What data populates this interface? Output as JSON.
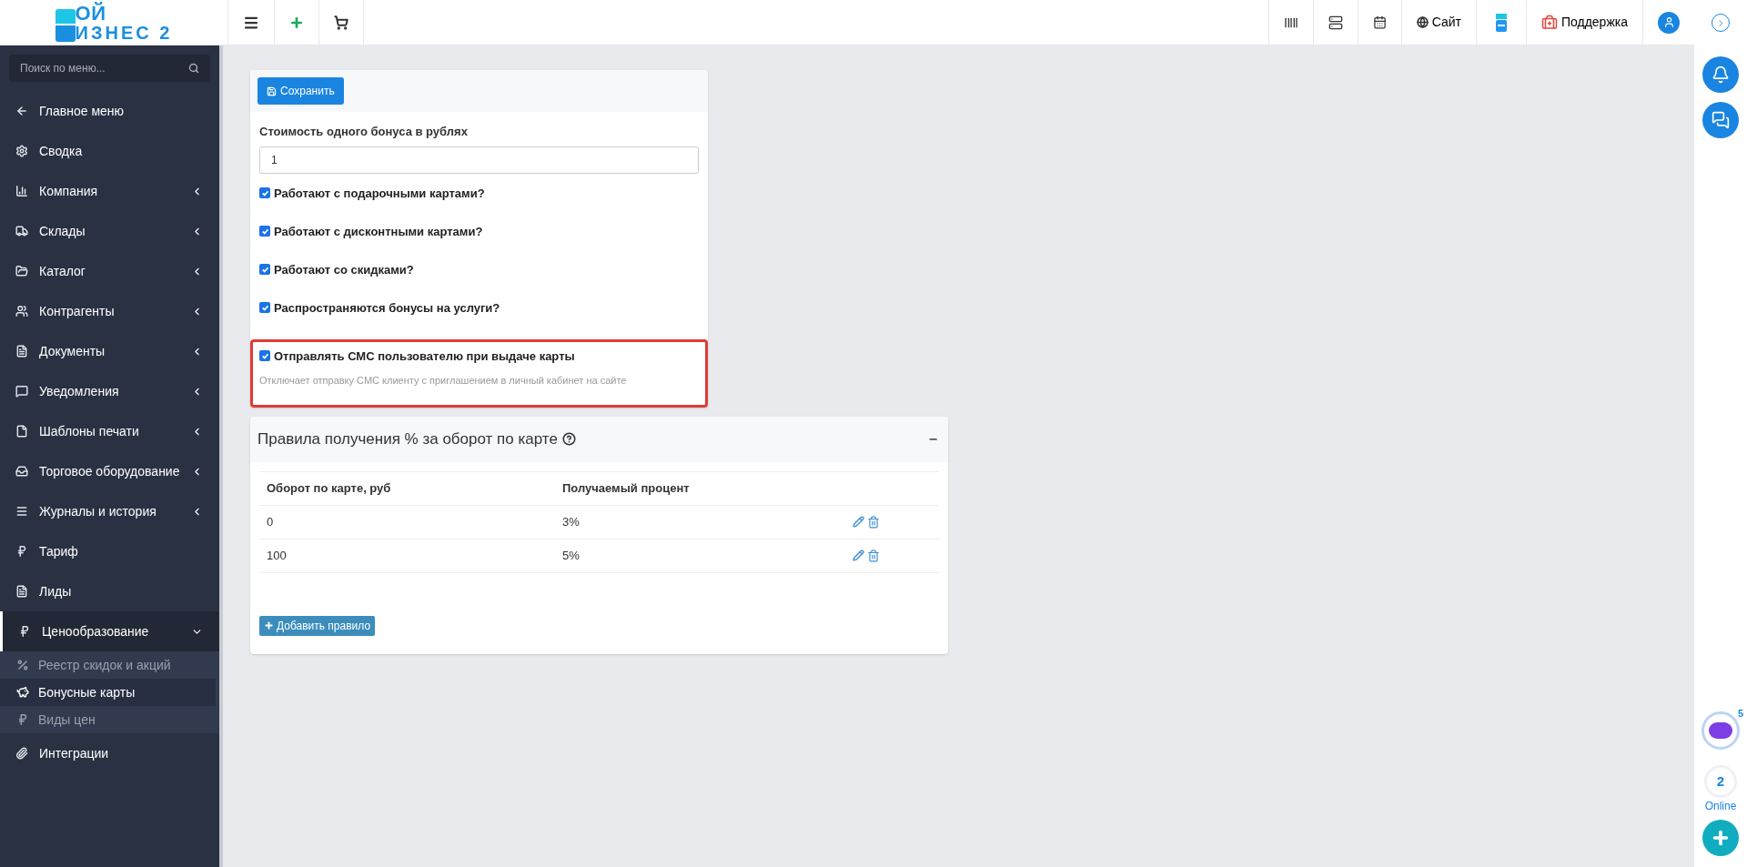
{
  "logo": {
    "line1": "ОЙ",
    "line2": "ИЗНЕС 2"
  },
  "topbar": {
    "site_label": "Сайт",
    "support_label": "Поддержка"
  },
  "sidebar": {
    "search_placeholder": "Поиск по меню...",
    "items": [
      {
        "label": "Главное меню",
        "has_children": false,
        "expanded": false
      },
      {
        "label": "Сводка",
        "has_children": false,
        "expanded": false
      },
      {
        "label": "Компания",
        "has_children": true,
        "expanded": false
      },
      {
        "label": "Склады",
        "has_children": true,
        "expanded": false
      },
      {
        "label": "Каталог",
        "has_children": true,
        "expanded": false
      },
      {
        "label": "Контрагенты",
        "has_children": true,
        "expanded": false
      },
      {
        "label": "Документы",
        "has_children": true,
        "expanded": false
      },
      {
        "label": "Уведомления",
        "has_children": true,
        "expanded": false
      },
      {
        "label": "Шаблоны печати",
        "has_children": true,
        "expanded": false
      },
      {
        "label": "Торговое оборудование",
        "has_children": true,
        "expanded": false
      },
      {
        "label": "Журналы и история",
        "has_children": true,
        "expanded": false
      },
      {
        "label": "Тариф",
        "has_children": false,
        "expanded": false
      },
      {
        "label": "Лиды",
        "has_children": false,
        "expanded": false
      },
      {
        "label": "Ценообразование",
        "has_children": true,
        "expanded": true,
        "children": [
          {
            "label": "Реестр скидок и акций",
            "selected": false
          },
          {
            "label": "Бонусные карты",
            "selected": true
          },
          {
            "label": "Виды цен",
            "selected": false
          }
        ]
      },
      {
        "label": "Интеграции",
        "has_children": false,
        "expanded": false
      }
    ]
  },
  "settings": {
    "save_label": "Сохранить",
    "cost_label": "Стоимость одного бонуса в рублях",
    "cost_value": "1",
    "options": [
      {
        "label": "Работают с подарочными картами?",
        "checked": true,
        "highlighted": false
      },
      {
        "label": "Работают с дисконтными картами?",
        "checked": true,
        "highlighted": false
      },
      {
        "label": "Работают со скидками?",
        "checked": true,
        "highlighted": false
      },
      {
        "label": "Распространяются бонусы на услуги?",
        "checked": true,
        "highlighted": false
      },
      {
        "label": "Отправлять СМС пользователю при выдаче карты",
        "checked": true,
        "highlighted": true,
        "hint": "Отключает отправку СМС клиенту с приглашением в личный кабинет на сайте"
      }
    ]
  },
  "rules": {
    "title": "Правила получения % за оборот по карте",
    "collapse_symbol": "−",
    "columns": [
      "Оборот по карте, руб",
      "Получаемый процент"
    ],
    "rows": [
      [
        "0",
        "3%"
      ],
      [
        "100",
        "5%"
      ]
    ],
    "add_label": "Добавить правило"
  },
  "right_rail": {
    "badge_count": "5",
    "online_count": "2",
    "online_label": "Online"
  }
}
